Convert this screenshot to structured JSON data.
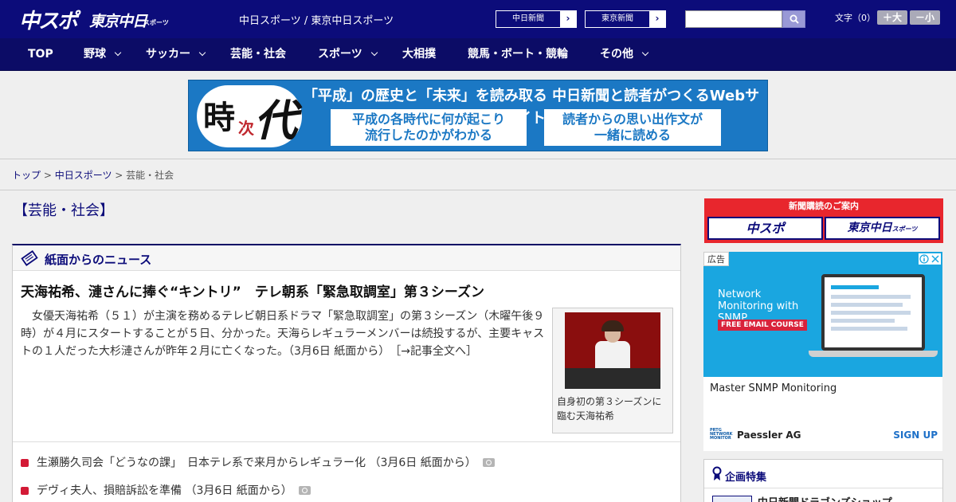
{
  "header": {
    "logo_main": "中スポ",
    "logo_tokyo": "東京中日",
    "logo_sub": "スポーツ",
    "site_name": "中日スポーツ / 東京中日スポーツ",
    "btn_chunichi": "中日新聞",
    "btn_tokyo": "東京新聞",
    "arrow": "›",
    "search_placeholder": "",
    "font_size_label": "文字（0）",
    "font_plus": "＋大",
    "font_minus": "－小"
  },
  "nav": [
    {
      "label": "TOP",
      "chevron": false
    },
    {
      "label": "野球",
      "chevron": true
    },
    {
      "label": "サッカー",
      "chevron": true
    },
    {
      "label": "芸能・社会",
      "chevron": false
    },
    {
      "label": "スポーツ",
      "chevron": true
    },
    {
      "label": "大相撲",
      "chevron": false
    },
    {
      "label": "競馬・ボート・競輪",
      "chevron": false
    },
    {
      "label": "その他",
      "chevron": true
    }
  ],
  "banner": {
    "ji": "時",
    "tsugi": "次",
    "dai": "代",
    "headline": "「平成」の歴史と「未来」を読み取る 中日新聞と読者がつくるWebサイト",
    "box1_line1": "平成の各時代に何が起こり",
    "box1_line2": "流行したのかがわかる",
    "box2_line1": "読者からの思い出作文が",
    "box2_line2": "一緒に読める"
  },
  "breadcrumb": {
    "home": "トップ",
    "sep": " > ",
    "section": "中日スポーツ",
    "current": "芸能・社会"
  },
  "page_title": "【芸能・社会】",
  "news": {
    "panel_title": "紙面からのニュース",
    "headline": "天海祐希、漣さんに捧ぐ“キントリ”　テレ朝系「緊急取調室」第３シーズン",
    "body": "女優天海祐希（５１）が主演を務めるテレビ朝日系ドラマ「緊急取調室」の第３シーズン（木曜午後９時）が４月にスタートすることが５日、分かった。天海らレギュラーメンバーは続投するが、主要キャストの１人だった大杉漣さんが昨年２月に亡くなった。（3月6日 紙面から）",
    "read_more": "［→記事全文へ］",
    "photo_caption": "自身初の第３シーズンに臨む天海祐希",
    "items": [
      "生瀬勝久司会「どうなの課」　日本テレ系で来月からレギュラー化 （3月6日 紙面から）",
      "デヴィ夫人、損賠訴訟を準備 （3月6日 紙面から）"
    ]
  },
  "sidebar": {
    "subscribe_head": "新聞購読のご案内",
    "sub_logo1": "中スポ",
    "sub_logo2": "東京中日",
    "sub_logo2_small": "スポーツ",
    "ad": {
      "tag": "広告",
      "headline": "Network Monitoring with SNMP",
      "badge": "FREE EMAIL COURSE",
      "title": "Master SNMP Monitoring",
      "brand_logo": "PRTG NETWORK MONITOR",
      "brand": "Paessler AG",
      "cta": "SIGN UP"
    },
    "feature_title": "企画特集",
    "feature_item": "中日新聞ドラゴンズショップ"
  },
  "colors": {
    "brand_navy": "#0c0c7a",
    "accent_red": "#d31a36",
    "banner_blue": "#1b78c4"
  }
}
